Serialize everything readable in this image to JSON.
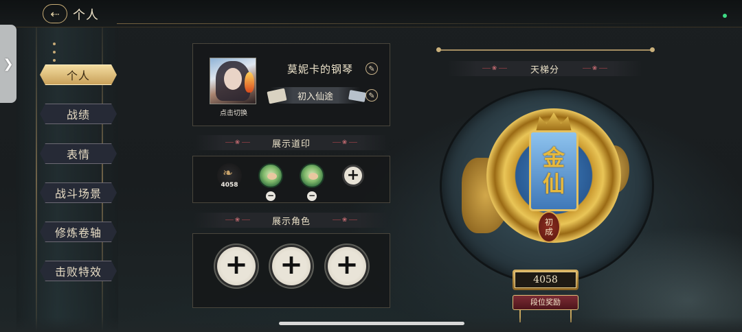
{
  "header": {
    "back_icon": "back-arrow-icon",
    "title": "个人"
  },
  "sidebar": {
    "items": [
      {
        "label": "个人",
        "active": true
      },
      {
        "label": "战绩",
        "active": false
      },
      {
        "label": "表情",
        "active": false
      },
      {
        "label": "战斗场景",
        "active": false
      },
      {
        "label": "修炼卷轴",
        "active": false
      },
      {
        "label": "击败特效",
        "active": false
      }
    ]
  },
  "profile": {
    "avatar_caption": "点击切换",
    "name": "莫妮卡的钢琴",
    "title": "初入仙途",
    "edit_icon": "pencil-icon"
  },
  "seals": {
    "header": "展示道印",
    "badge_value": "4058",
    "add_icon": "plus-icon",
    "remove_icon": "minus-icon"
  },
  "characters": {
    "header": "展示角色",
    "add_icon": "plus-icon"
  },
  "ladder": {
    "header": "天梯分",
    "rank_name_line1": "金",
    "rank_name_line2": "仙",
    "tier_line1": "初",
    "tier_line2": "成",
    "score": "4058",
    "reward_button": "段位奖励"
  },
  "colors": {
    "gold": "#c9a15a",
    "panel_border": "#4a463c",
    "accent_red": "#b9505a",
    "status_green": "#3ddc84"
  }
}
